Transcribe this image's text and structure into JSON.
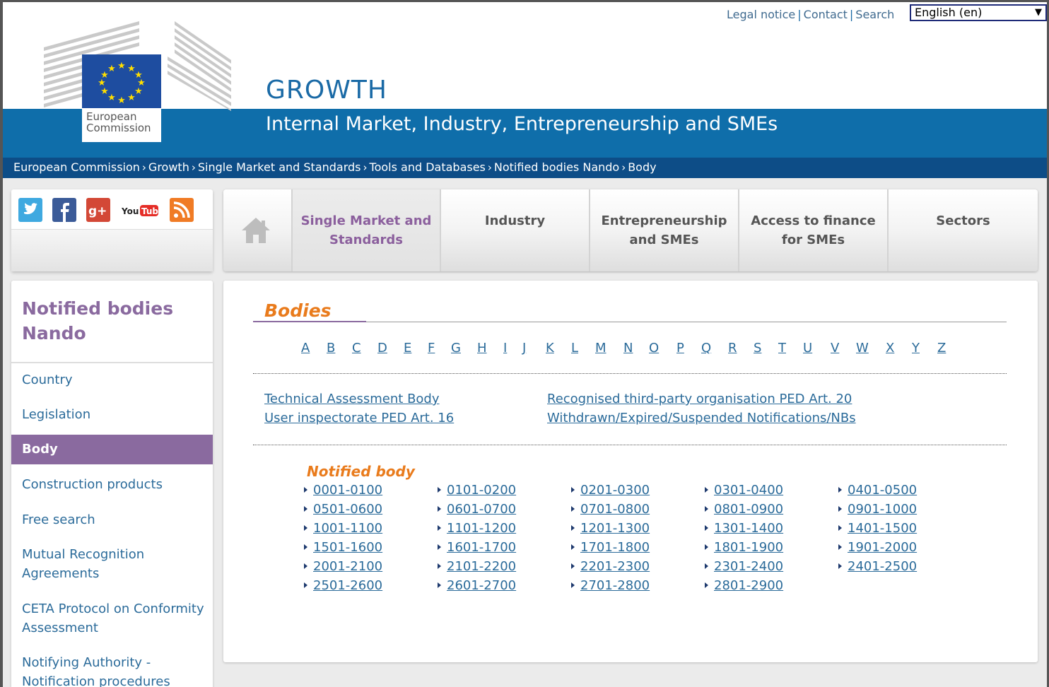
{
  "header": {
    "logo_text": [
      "European",
      "Commission"
    ],
    "title": "GROWTH",
    "subtitle": "Internal Market, Industry, Entrepreneurship and SMEs",
    "top_links": [
      "Legal notice",
      "Contact",
      "Search"
    ],
    "language": "English (en)"
  },
  "breadcrumb": [
    "European Commission",
    "Growth",
    "Single Market and Standards",
    "Tools and Databases",
    "Notified bodies Nando",
    "Body"
  ],
  "social": [
    "twitter-icon",
    "facebook-icon",
    "google-plus-icon",
    "youtube-icon",
    "rss-icon"
  ],
  "nav": {
    "home_icon": "home-icon",
    "tabs": [
      {
        "label": "Single Market and Standards",
        "active": true
      },
      {
        "label": "Industry",
        "active": false
      },
      {
        "label": "Entrepreneurship and SMEs",
        "active": false
      },
      {
        "label": "Access to finance for SMEs",
        "active": false
      },
      {
        "label": "Sectors",
        "active": false
      }
    ]
  },
  "sidebar": {
    "title": "Notified bodies Nando",
    "items": [
      "Country",
      "Legislation",
      "Body",
      "Construction products",
      "Free search",
      "Mutual Recognition Agreements",
      "CETA Protocol on Conformity Assessment",
      "Notifying Authority - Notification procedures"
    ],
    "active": "Body"
  },
  "main": {
    "title": "Bodies",
    "letters": [
      "A",
      "B",
      "C",
      "D",
      "E",
      "F",
      "G",
      "H",
      "I",
      "J",
      "K",
      "L",
      "M",
      "N",
      "O",
      "P",
      "Q",
      "R",
      "S",
      "T",
      "U",
      "V",
      "W",
      "X",
      "Y",
      "Z"
    ],
    "links": [
      "Technical Assessment Body",
      "Recognised third-party organisation PED Art. 20",
      "User inspectorate PED Art. 16",
      "Withdrawn/Expired/Suspended Notifications/NBs"
    ],
    "notified_title": "Notified body",
    "ranges": [
      [
        "0001-0100",
        "0101-0200",
        "0201-0300",
        "0301-0400",
        "0401-0500"
      ],
      [
        "0501-0600",
        "0601-0700",
        "0701-0800",
        "0801-0900",
        "0901-1000"
      ],
      [
        "1001-1100",
        "1101-1200",
        "1201-1300",
        "1301-1400",
        "1401-1500"
      ],
      [
        "1501-1600",
        "1601-1700",
        "1701-1800",
        "1801-1900",
        "1901-2000"
      ],
      [
        "2001-2100",
        "2101-2200",
        "2201-2300",
        "2301-2400",
        "2401-2500"
      ],
      [
        "2501-2600",
        "2601-2700",
        "2701-2800",
        "2801-2900"
      ]
    ]
  },
  "colors": {
    "header_blue": "#0f6eaa",
    "breadcrumb_blue": "#0d4d87",
    "accent_purple": "#8a6a9f",
    "accent_orange": "#e97b1c",
    "link_blue": "#2b6b9a"
  }
}
